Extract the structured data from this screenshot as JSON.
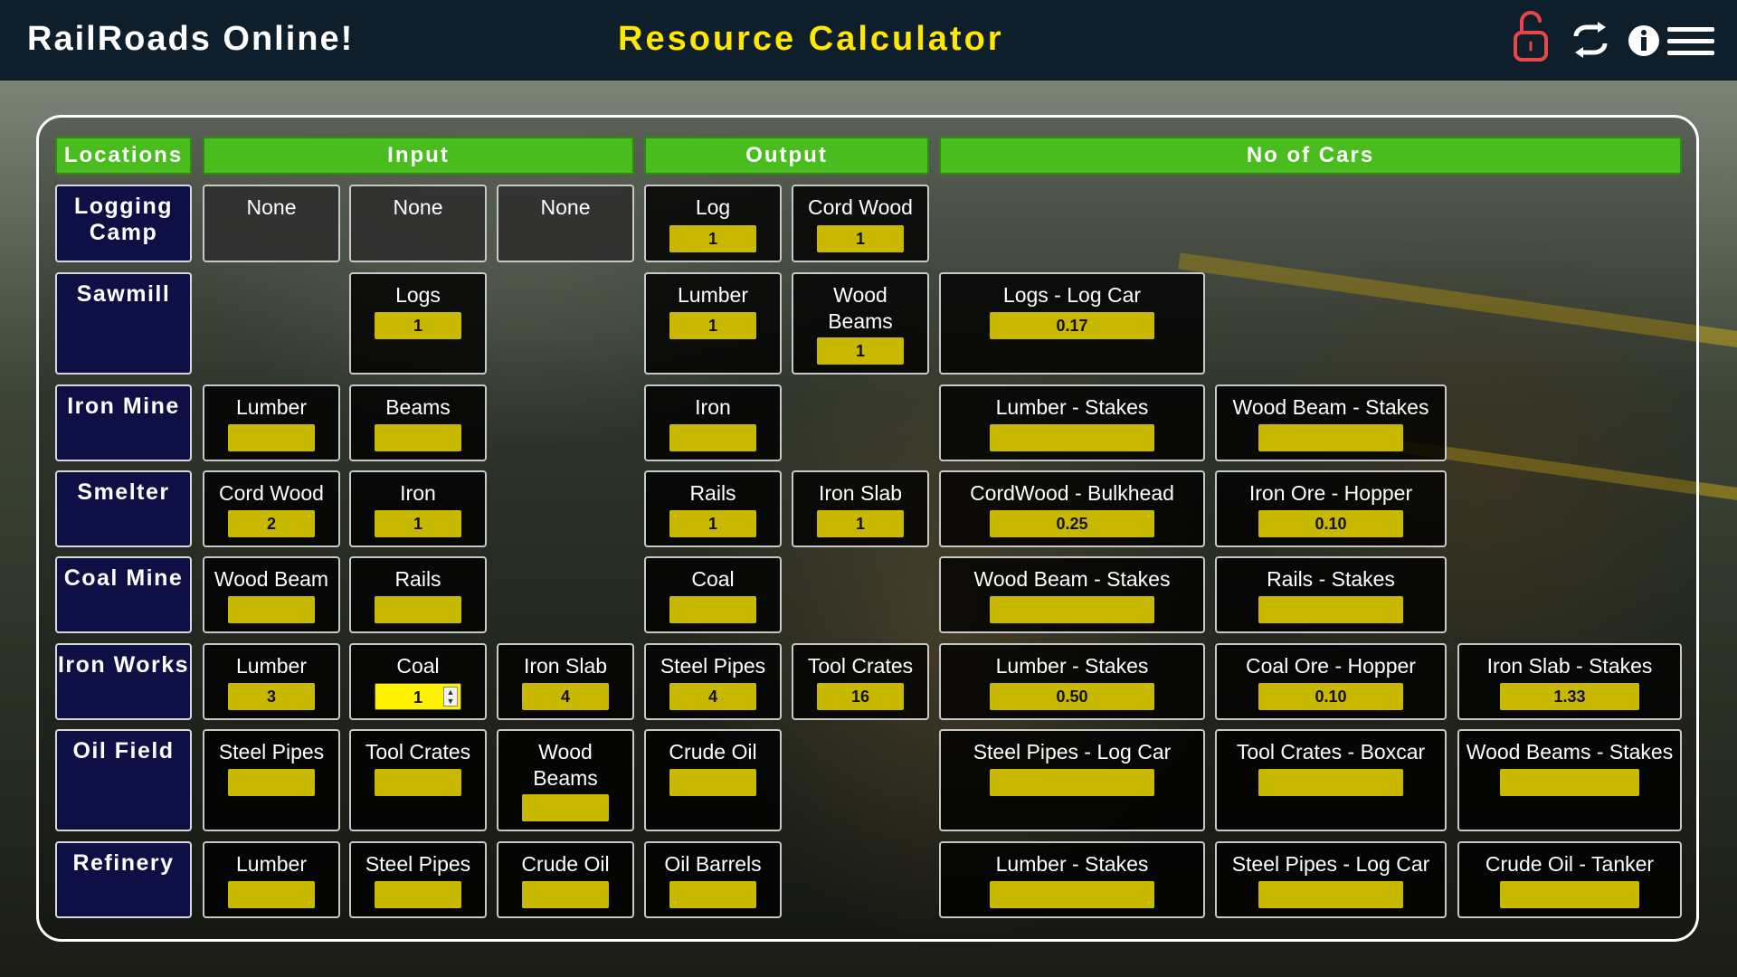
{
  "app": {
    "title": "RailRoads Online!",
    "page_title": "Resource Calculator",
    "icons": [
      "unlock-icon",
      "swap-icon",
      "info-icon",
      "menu-icon"
    ]
  },
  "headers": {
    "locations": "Locations",
    "input": "Input",
    "output": "Output",
    "cars": "No of Cars"
  },
  "rows": [
    {
      "location": "Logging Camp",
      "inputs": [
        {
          "label": "None"
        },
        {
          "label": "None"
        },
        {
          "label": "None"
        }
      ],
      "outputs": [
        {
          "label": "Log",
          "value": "1"
        },
        {
          "label": "Cord Wood",
          "value": "1"
        }
      ],
      "cars": []
    },
    {
      "location": "Sawmill",
      "inputs": [
        {
          "label": "Logs",
          "value": "1"
        }
      ],
      "outputs": [
        {
          "label": "Lumber",
          "value": "1"
        },
        {
          "label": "Wood Beams",
          "value": "1"
        }
      ],
      "cars": [
        {
          "label": "Logs - Log Car",
          "value": "0.17"
        }
      ]
    },
    {
      "location": "Iron Mine",
      "inputs": [
        {
          "label": "Lumber",
          "value": ""
        },
        {
          "label": "Beams",
          "value": ""
        }
      ],
      "outputs": [
        {
          "label": "Iron",
          "value": ""
        }
      ],
      "cars": [
        {
          "label": "Lumber - Stakes",
          "value": ""
        },
        {
          "label": "Wood Beam - Stakes",
          "value": ""
        }
      ]
    },
    {
      "location": "Smelter",
      "inputs": [
        {
          "label": "Cord Wood",
          "value": "2"
        },
        {
          "label": "Iron",
          "value": "1"
        }
      ],
      "outputs": [
        {
          "label": "Rails",
          "value": "1"
        },
        {
          "label": "Iron Slab",
          "value": "1"
        }
      ],
      "cars": [
        {
          "label": "CordWood - Bulkhead",
          "value": "0.25"
        },
        {
          "label": "Iron Ore - Hopper",
          "value": "0.10"
        }
      ]
    },
    {
      "location": "Coal Mine",
      "inputs": [
        {
          "label": "Wood Beam",
          "value": ""
        },
        {
          "label": "Rails",
          "value": ""
        }
      ],
      "outputs": [
        {
          "label": "Coal",
          "value": ""
        }
      ],
      "cars": [
        {
          "label": "Wood Beam - Stakes",
          "value": ""
        },
        {
          "label": "Rails - Stakes",
          "value": ""
        }
      ]
    },
    {
      "location": "Iron Works",
      "inputs": [
        {
          "label": "Lumber",
          "value": "3"
        },
        {
          "label": "Coal",
          "value": "1"
        },
        {
          "label": "Iron Slab",
          "value": "4"
        }
      ],
      "outputs": [
        {
          "label": "Steel Pipes",
          "value": "4"
        },
        {
          "label": "Tool Crates",
          "value": "16"
        }
      ],
      "cars": [
        {
          "label": "Lumber - Stakes",
          "value": "0.50"
        },
        {
          "label": "Coal Ore - Hopper",
          "value": "0.10"
        },
        {
          "label": "Iron Slab - Stakes",
          "value": "1.33"
        }
      ]
    },
    {
      "location": "Oil Field",
      "inputs": [
        {
          "label": "Steel Pipes",
          "value": ""
        },
        {
          "label": "Tool Crates",
          "value": ""
        },
        {
          "label": "Wood Beams",
          "value": ""
        }
      ],
      "outputs": [
        {
          "label": "Crude Oil",
          "value": ""
        }
      ],
      "cars": [
        {
          "label": "Steel Pipes - Log Car",
          "value": ""
        },
        {
          "label": "Tool Crates - Boxcar",
          "value": ""
        },
        {
          "label": "Wood Beams - Stakes",
          "value": ""
        }
      ]
    },
    {
      "location": "Refinery",
      "inputs": [
        {
          "label": "Lumber",
          "value": ""
        },
        {
          "label": "Steel Pipes",
          "value": ""
        },
        {
          "label": "Crude Oil",
          "value": ""
        }
      ],
      "outputs": [
        {
          "label": "Oil Barrels",
          "value": ""
        }
      ],
      "cars": [
        {
          "label": "Lumber - Stakes",
          "value": ""
        },
        {
          "label": "Steel Pipes - Log Car",
          "value": ""
        },
        {
          "label": "Crude Oil - Tanker",
          "value": ""
        }
      ]
    }
  ],
  "colors": {
    "header_green": "#49bd1d",
    "title_yellow": "#ffe800",
    "value_yellow": "#c8b800",
    "location_blue": "#0d0f45",
    "topbar": "#0f1e2b",
    "unlock_red": "#e8474a"
  }
}
